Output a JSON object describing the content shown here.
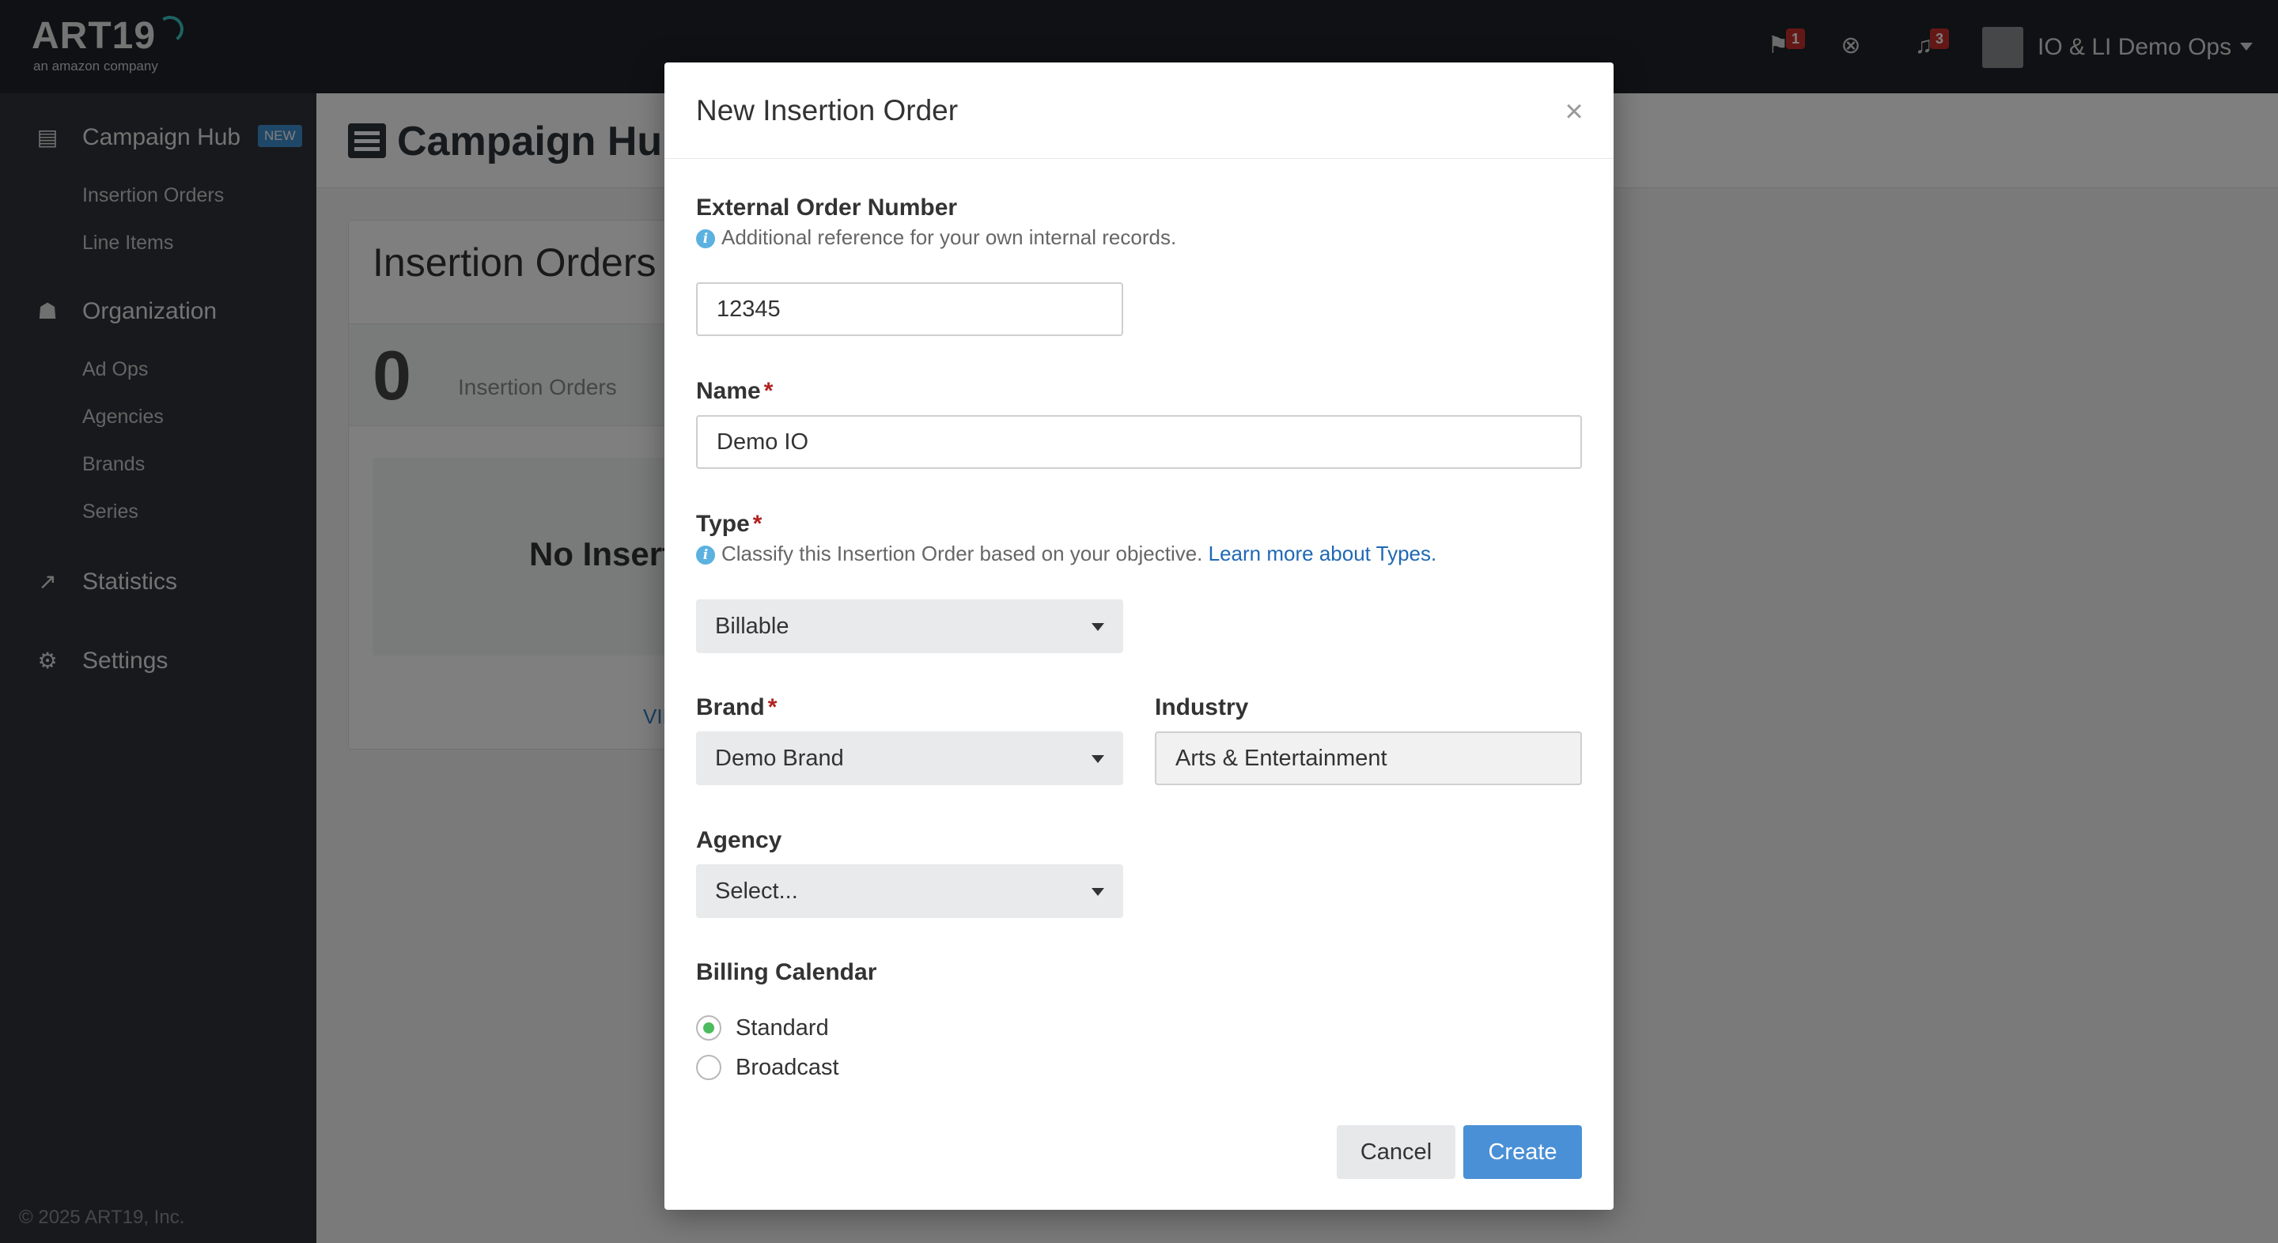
{
  "brand": {
    "logo_text": "ART19",
    "logo_sub": "an amazon company"
  },
  "topbar": {
    "flag_badge": "1",
    "bell_badge": "3",
    "user_name": "IO & LI Demo Ops",
    "icons": [
      "flag-icon",
      "support-icon",
      "bell-icon",
      "avatar",
      "chevron-down-icon"
    ]
  },
  "sidebar": {
    "sections": [
      {
        "label": "Campaign Hub",
        "icon": "list-icon",
        "badge": "NEW",
        "items": [
          "Insertion Orders",
          "Line Items"
        ]
      },
      {
        "label": "Organization",
        "icon": "users-icon",
        "items": [
          "Ad Ops",
          "Agencies",
          "Brands",
          "Series"
        ]
      },
      {
        "label": "Statistics",
        "icon": "chart-icon",
        "items": []
      },
      {
        "label": "Settings",
        "icon": "gear-icon",
        "items": []
      }
    ],
    "footer": "© 2025 ART19, Inc."
  },
  "main": {
    "page_title": "Campaign Hub",
    "card_title": "Insertion Orders",
    "count": "0",
    "count_label": "Insertion Orders",
    "empty_text": "No Insertion",
    "view_link": "VIEW"
  },
  "modal": {
    "title": "New Insertion Order",
    "close": "×",
    "external_order": {
      "label": "External Order Number",
      "help": "Additional reference for your own internal records.",
      "value": "12345"
    },
    "name": {
      "label": "Name",
      "required": "*",
      "value": "Demo IO"
    },
    "type": {
      "label": "Type",
      "required": "*",
      "help": "Classify this Insertion Order based on your objective.",
      "help_link": "Learn more about Types.",
      "value": "Billable"
    },
    "brand": {
      "label": "Brand",
      "required": "*",
      "value": "Demo Brand"
    },
    "industry": {
      "label": "Industry",
      "value": "Arts & Entertainment"
    },
    "agency": {
      "label": "Agency",
      "value": "Select..."
    },
    "billing_calendar": {
      "label": "Billing Calendar",
      "options": [
        {
          "label": "Standard",
          "checked": true
        },
        {
          "label": "Broadcast",
          "checked": false
        }
      ]
    },
    "cancel_label": "Cancel",
    "create_label": "Create"
  },
  "colors": {
    "topbar_bg": "#1f2328",
    "sidebar_bg": "#2e3338",
    "primary_button": "#4a90d6",
    "required": "#b22222",
    "radio_checked": "#4cbb5f",
    "link": "#2068b5"
  }
}
